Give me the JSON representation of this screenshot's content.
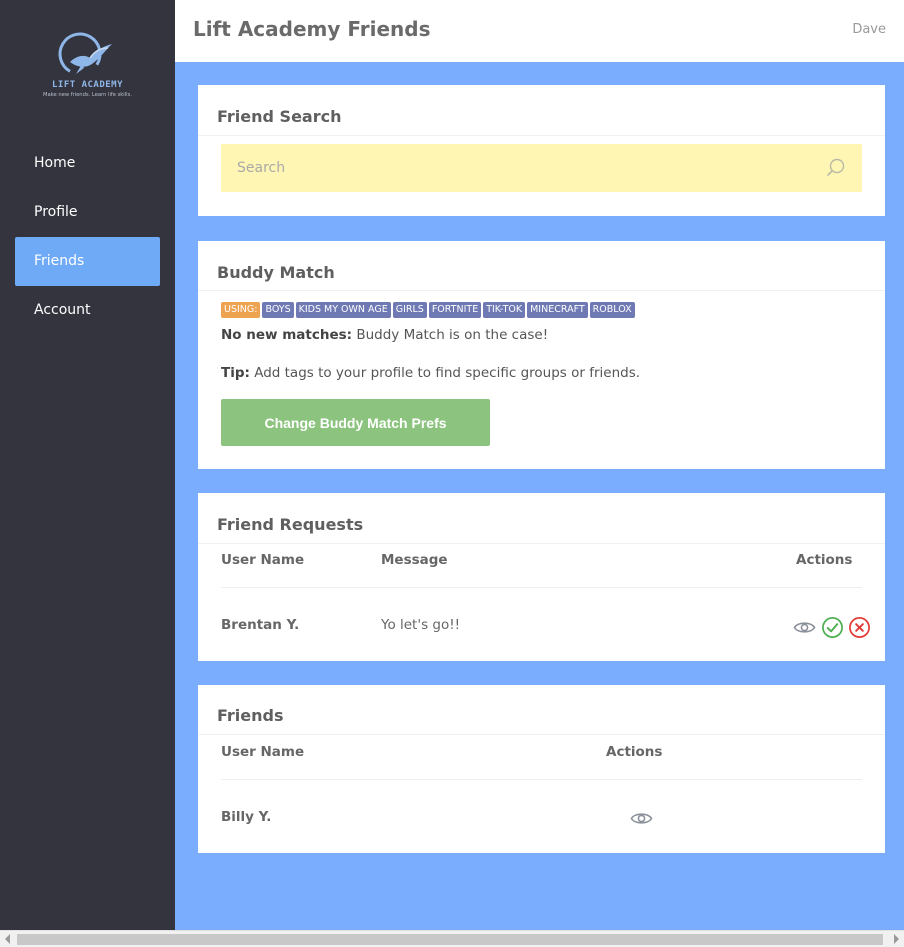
{
  "app": {
    "logo_title": "LIFT ACADEMY",
    "logo_tagline": "Make new friends. Learn life skills.",
    "page_title": "Lift Academy Friends",
    "user": "Dave"
  },
  "sidebar": {
    "items": [
      {
        "label": "Home",
        "active": false
      },
      {
        "label": "Profile",
        "active": false
      },
      {
        "label": "Friends",
        "active": true
      },
      {
        "label": "Account",
        "active": false
      }
    ]
  },
  "friend_search": {
    "title": "Friend Search",
    "placeholder": "Search",
    "icon": "search-icon"
  },
  "buddy_match": {
    "title": "Buddy Match",
    "using_label": "USING:",
    "tags": [
      "BOYS",
      "KIDS MY OWN AGE",
      "GIRLS",
      "FORTNITE",
      "TIK-TOK",
      "MINECRAFT",
      "ROBLOX"
    ],
    "status_bold": "No new matches:",
    "status_text": " Buddy Match is on the case!",
    "tip_bold": "Tip:",
    "tip_text": " Add tags to your profile to find specific groups or friends.",
    "button_label": "Change Buddy Match Prefs"
  },
  "friend_requests": {
    "title": "Friend Requests",
    "columns": [
      "User Name",
      "Message",
      "Actions"
    ],
    "rows": [
      {
        "user": "Brentan Y.",
        "message": "Yo let's go!!",
        "actions": [
          "eye-icon",
          "accept-check-icon",
          "reject-x-icon"
        ]
      }
    ]
  },
  "friends": {
    "title": "Friends",
    "columns": [
      "User Name",
      "Actions"
    ],
    "rows": [
      {
        "user": "Billy Y.",
        "actions": [
          "eye-icon"
        ]
      }
    ]
  },
  "colors": {
    "sidebar_bg": "#34343f",
    "page_bg": "#7aadfd",
    "active_nav": "#6faaf6",
    "search_bg": "#fff6b3",
    "tag_bg": "#6f7ab5",
    "using_tag_bg": "#eea350",
    "button_green": "#8cc47f",
    "accept_green": "#4caf50",
    "reject_red": "#e53935"
  }
}
